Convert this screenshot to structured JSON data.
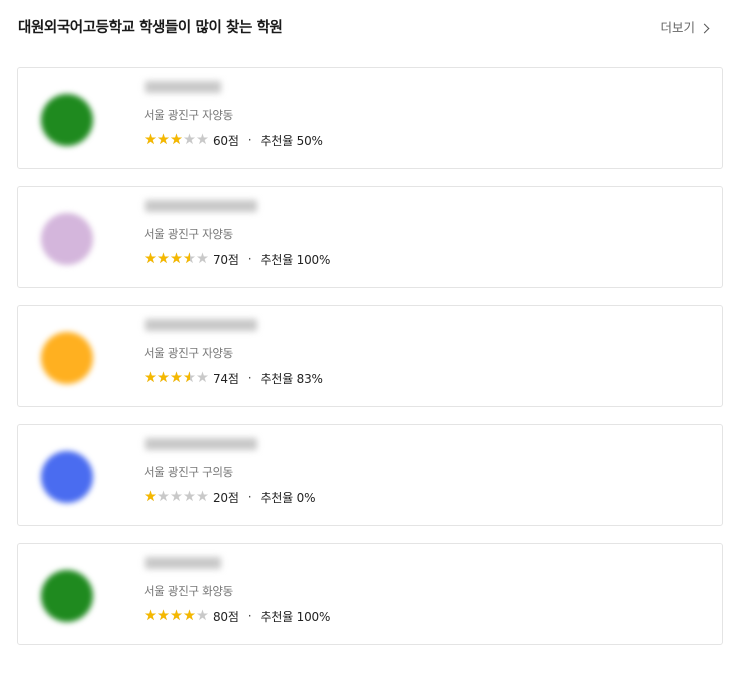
{
  "header": {
    "title": "대원외국어고등학교 학생들이 많이 찾는 학원",
    "more_label": "더보기"
  },
  "icons": {
    "chevron": "chevron-right-icon",
    "star": "star-icon"
  },
  "colors": {
    "star_filled": "#f5b800",
    "star_empty": "#c9c9c9",
    "border": "#e4e4e4"
  },
  "academies": [
    {
      "logo_color": "#1f8a1f",
      "address": "서울 광진구 자양동",
      "rating_stars": 3.0,
      "score": "60점",
      "separator": "·",
      "recommend": "추천율 50%"
    },
    {
      "logo_color": "#d4b6dc",
      "address": "서울 광진구 자양동",
      "rating_stars": 3.5,
      "score": "70점",
      "separator": "·",
      "recommend": "추천율 100%"
    },
    {
      "logo_color": "#ffb020",
      "address": "서울 광진구 자양동",
      "rating_stars": 3.5,
      "score": "74점",
      "separator": "·",
      "recommend": "추천율 83%"
    },
    {
      "logo_color": "#4a6cf0",
      "address": "서울 광진구 구의동",
      "rating_stars": 1.0,
      "score": "20점",
      "separator": "·",
      "recommend": "추천율 0%"
    },
    {
      "logo_color": "#1f8a1f",
      "address": "서울 광진구 화양동",
      "rating_stars": 4.0,
      "score": "80점",
      "separator": "·",
      "recommend": "추천율 100%"
    }
  ]
}
